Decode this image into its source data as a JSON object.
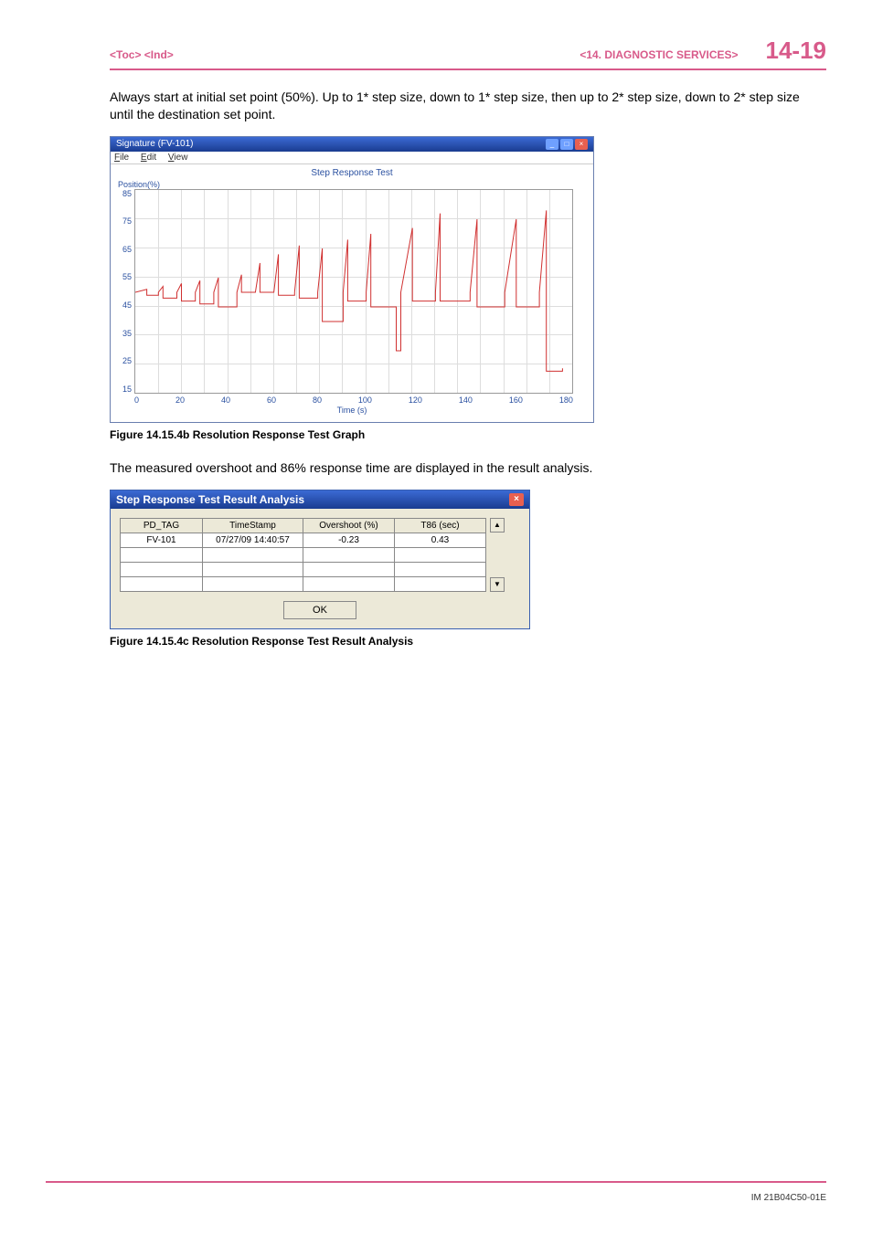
{
  "header": {
    "left": "<Toc> <Ind>",
    "section": "<14.  DIAGNOSTIC SERVICES>",
    "page": "14-19"
  },
  "paragraph1": "Always start at initial set point (50%). Up to 1* step size, down to 1* step size, then up to 2* step size, down to 2* step size until the destination set point.",
  "paragraph2": "The measured overshoot and 86% response time are displayed in the result analysis.",
  "fig1_caption": "Figure 14.15.4b   Resolution Response Test Graph",
  "fig2_caption": "Figure 14.15.4c   Resolution Response Test Result Analysis",
  "doc_code": "IM 21B04C50-01E",
  "chart_window": {
    "title": "Signature (FV-101)",
    "menu_file": "File",
    "menu_edit": "Edit",
    "menu_view": "View"
  },
  "chart_data": {
    "type": "line",
    "title": "Step Response Test",
    "xlabel": "Time (s)",
    "ylabel": "Position(%)",
    "xlim": [
      0,
      190
    ],
    "ylim": [
      15,
      85
    ],
    "x_ticks": [
      "0",
      "20",
      "40",
      "60",
      "80",
      "100",
      "120",
      "140",
      "160",
      "180"
    ],
    "y_ticks": [
      "85",
      "75",
      "65",
      "55",
      "45",
      "35",
      "25",
      "15"
    ],
    "series": [
      {
        "name": "position",
        "points": [
          [
            0,
            50
          ],
          [
            5,
            51
          ],
          [
            5,
            49
          ],
          [
            10,
            49
          ],
          [
            10,
            50
          ],
          [
            12,
            52
          ],
          [
            12,
            48
          ],
          [
            18,
            48
          ],
          [
            18,
            50
          ],
          [
            20,
            53
          ],
          [
            20,
            47
          ],
          [
            26,
            47
          ],
          [
            26,
            50
          ],
          [
            28,
            54
          ],
          [
            28,
            46
          ],
          [
            34,
            46
          ],
          [
            34,
            50
          ],
          [
            36,
            55
          ],
          [
            36,
            45
          ],
          [
            44,
            45
          ],
          [
            44,
            50
          ],
          [
            46,
            56
          ],
          [
            46,
            50
          ],
          [
            52,
            50
          ],
          [
            52,
            50
          ],
          [
            54,
            60
          ],
          [
            54,
            50
          ],
          [
            60,
            50
          ],
          [
            60,
            50
          ],
          [
            62,
            63
          ],
          [
            62,
            49
          ],
          [
            69,
            49
          ],
          [
            69,
            50
          ],
          [
            71,
            66
          ],
          [
            71,
            48
          ],
          [
            79,
            48
          ],
          [
            79,
            50
          ],
          [
            81,
            65
          ],
          [
            81,
            40
          ],
          [
            90,
            40
          ],
          [
            90,
            50
          ],
          [
            92,
            68
          ],
          [
            92,
            47
          ],
          [
            100,
            47
          ],
          [
            100,
            50
          ],
          [
            102,
            70
          ],
          [
            102,
            45
          ],
          [
            113,
            45
          ],
          [
            113,
            30
          ],
          [
            115,
            30
          ],
          [
            115,
            50
          ],
          [
            120,
            72
          ],
          [
            120,
            47
          ],
          [
            130,
            47
          ],
          [
            130,
            50
          ],
          [
            132,
            77
          ],
          [
            132,
            47
          ],
          [
            145,
            47
          ],
          [
            145,
            50
          ],
          [
            148,
            75
          ],
          [
            148,
            45
          ],
          [
            160,
            45
          ],
          [
            160,
            50
          ],
          [
            165,
            75
          ],
          [
            165,
            45
          ],
          [
            175,
            45
          ],
          [
            175,
            50
          ],
          [
            178,
            78
          ],
          [
            178,
            23
          ],
          [
            185,
            23
          ],
          [
            185,
            24
          ]
        ]
      }
    ]
  },
  "dialog": {
    "title": "Step Response Test Result Analysis",
    "headers": {
      "c1": "PD_TAG",
      "c2": "TimeStamp",
      "c3": "Overshoot (%)",
      "c4": "T86 (sec)"
    },
    "row1": {
      "c1": "FV-101",
      "c2": "07/27/09 14:40:57",
      "c3": "-0.23",
      "c4": "0.43"
    },
    "ok": "OK"
  }
}
